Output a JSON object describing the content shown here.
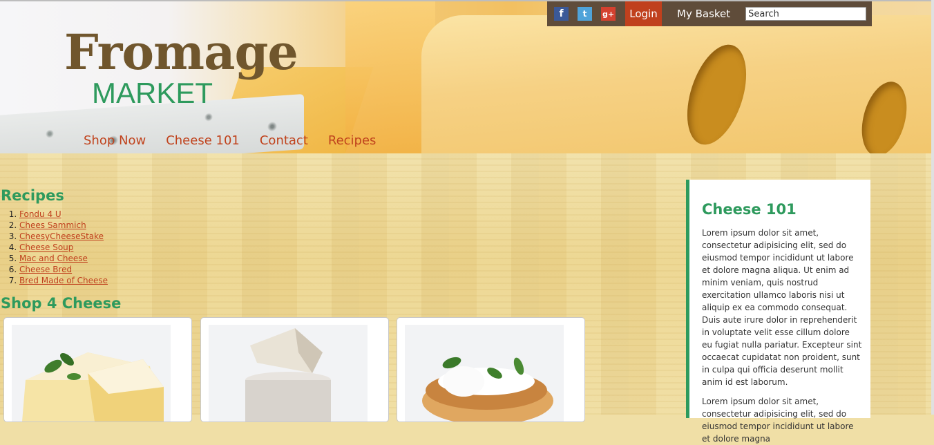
{
  "brand": {
    "name": "Fromage",
    "sub": "MARKET"
  },
  "topbar": {
    "social": {
      "facebook": "f",
      "twitter": "t",
      "googleplus": "g+"
    },
    "login_label": "Login",
    "basket_label": "My Basket",
    "search_placeholder": "Search"
  },
  "nav": [
    "Shop Now",
    "Cheese 101",
    "Contact",
    "Recipes"
  ],
  "recipes": {
    "title": "Recipes",
    "items": [
      "Fondu 4 U",
      "Chees Sammich",
      "CheesyCheeseStake",
      "Cheese Soup",
      "Mac and Cheese",
      "Cheese Bred",
      "Bred Made of Cheese"
    ]
  },
  "shop": {
    "title": "Shop 4 Cheese",
    "product_icons": [
      "camembert-image",
      "goat-cheese-image",
      "cheese-toast-image"
    ]
  },
  "sidebar": {
    "title": "Cheese 101",
    "paragraph1": "Lorem ipsum dolor sit amet, consectetur adipisicing elit, sed do eiusmod tempor incididunt ut labore et dolore magna aliqua. Ut enim ad minim veniam, quis nostrud exercitation ullamco laboris nisi ut aliquip ex ea commodo consequat. Duis aute irure dolor in reprehenderit in voluptate velit esse cillum dolore eu fugiat nulla pariatur. Excepteur sint occaecat cupidatat non proident, sunt in culpa qui officia deserunt mollit anim id est laborum.",
    "paragraph2": "Lorem ipsum dolor sit amet, consectetur adipisicing elit, sed do eiusmod tempor incididunt ut labore et dolore magna"
  },
  "colors": {
    "brown": "#70562d",
    "green": "#2e9a5d",
    "red": "#c0401d",
    "topbar": "#5f4c3a"
  }
}
